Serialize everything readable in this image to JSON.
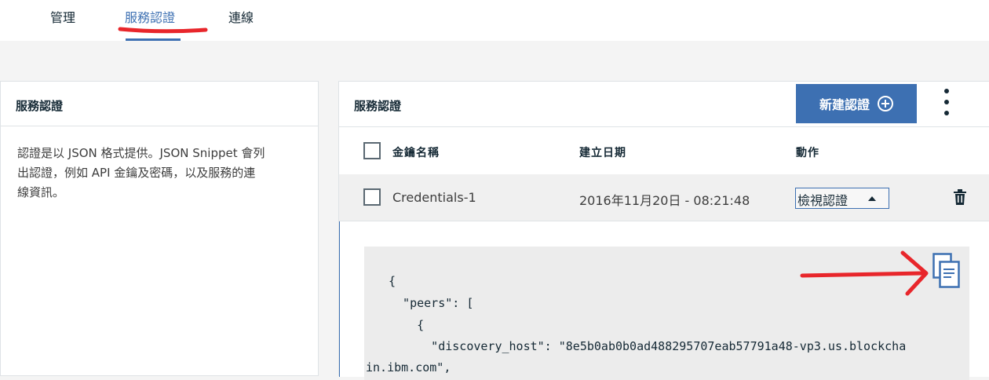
{
  "tabs": [
    {
      "label": "管理"
    },
    {
      "label": "服務認證"
    },
    {
      "label": "連線"
    }
  ],
  "active_tab": "服務認證",
  "left_panel": {
    "title": "服務認證",
    "description_lines": [
      "認證是以 JSON 格式提供。JSON Snippet 會列",
      "出認證，例如 API 金鑰及密碼，以及服務的連",
      "線資訊。"
    ]
  },
  "right_panel": {
    "title": "服務認證",
    "new_button_label": "新建認證",
    "columns": {
      "name": "金鑰名稱",
      "created": "建立日期",
      "actions": "動作"
    },
    "row": {
      "name": "Credentials-1",
      "created": "2016年11月20日 - 08:21:48",
      "action_select": "檢視認證"
    },
    "code_lines": [
      "{",
      "  \"peers\": [",
      "    {",
      "      \"discovery_host\": \"8e5b0ab0b0ad488295707eab57791a48-vp3.us.blockcha",
      "in.ibm.com\","
    ]
  },
  "colors": {
    "accent": "#3d70b2",
    "annotation": "#e8262b"
  },
  "icons": [
    "plus-circle-icon",
    "kebab-menu-icon",
    "trash-icon",
    "copy-icon",
    "caret-up-icon"
  ]
}
